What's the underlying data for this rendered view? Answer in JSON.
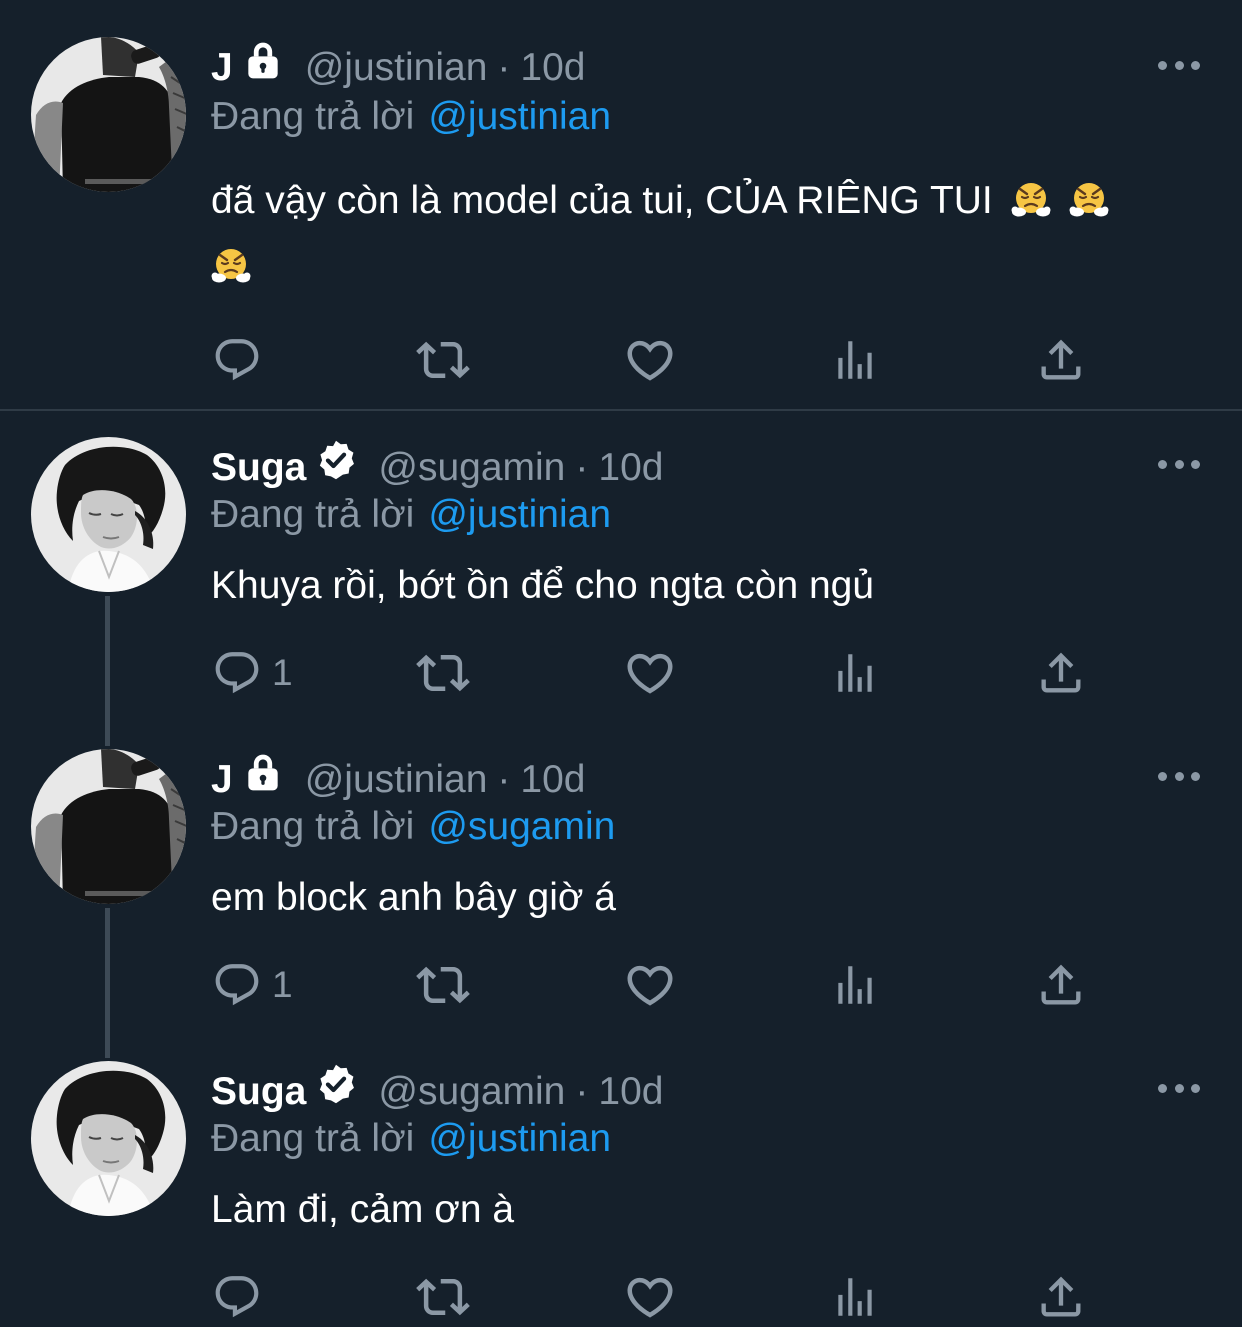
{
  "colors": {
    "background": "#15202b",
    "text": "#ffffff",
    "muted": "#8b98a5",
    "accent": "#1d9bf0",
    "separator": "#2f3b46",
    "thread_line": "#3d4a56"
  },
  "replying_label": "Đang trả lời",
  "tweets": [
    {
      "name": "J",
      "badge": "lock-icon",
      "handle": "@justinian",
      "dot": "·",
      "time": "10d",
      "reply_to": "@justinian",
      "text": "đã vậy còn là model của tui, CỦA RIÊNG TUI",
      "emoji": [
        "face-with-steam-from-nose",
        "face-with-steam-from-nose",
        "face-with-steam-from-nose"
      ],
      "reply_count": ""
    },
    {
      "name": "Suga",
      "badge": "verified-badge-icon",
      "handle": "@sugamin",
      "dot": "·",
      "time": "10d",
      "reply_to": "@justinian",
      "text": "Khuya rồi, bớt ồn để cho ngta còn ngủ",
      "reply_count": "1"
    },
    {
      "name": "J",
      "badge": "lock-icon",
      "handle": "@justinian",
      "dot": "·",
      "time": "10d",
      "reply_to": "@sugamin",
      "text": "em block anh bây giờ á",
      "reply_count": "1"
    },
    {
      "name": "Suga",
      "badge": "verified-badge-icon",
      "handle": "@sugamin",
      "dot": "·",
      "time": "10d",
      "reply_to": "@justinian",
      "text": "Làm đi, cảm ơn à",
      "reply_count": ""
    }
  ],
  "action_icons": [
    "reply-icon",
    "retweet-icon",
    "like-icon",
    "views-icon",
    "share-icon"
  ]
}
